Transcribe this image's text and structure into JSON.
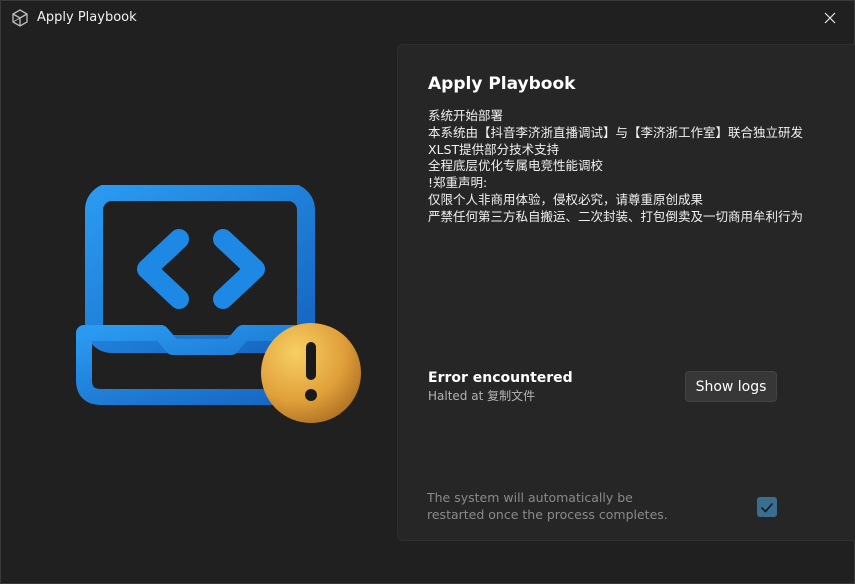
{
  "window": {
    "title": "Apply Playbook"
  },
  "icons": {
    "app": "box-logo-icon",
    "close": "close-icon",
    "hero": "laptop-code-warning-icon",
    "check": "checkmark-icon"
  },
  "main": {
    "title": "Apply Playbook",
    "description_lines": [
      "系统开始部署",
      "本系统由【抖音李济浙直播调试】与【李济浙工作室】联合独立研发",
      "XLST提供部分技术支持",
      "全程底层优化专属电竞性能调校",
      "!郑重声明:",
      "仅限个人非商用体验，侵权必究，请尊重原创成果",
      "严禁任何第三方私自搬运、二次封装、打包倒卖及一切商用牟利行为"
    ],
    "error": {
      "title": "Error encountered",
      "subtitle": "Halted at 复制文件"
    },
    "show_logs_label": "Show logs",
    "restart_notice": "The system will automatically be restarted once the process completes.",
    "auto_restart_checked": true
  },
  "colors": {
    "accent_blue": "#1e88e5",
    "warning_gold": "#e8a93a",
    "checkbox": "#3a6e8f"
  }
}
